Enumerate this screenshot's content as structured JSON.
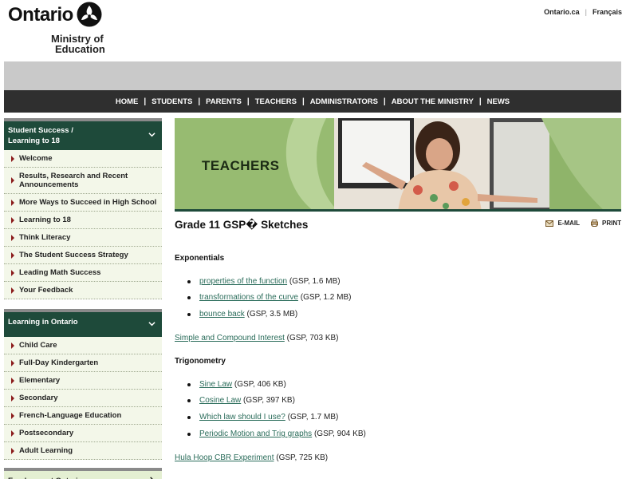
{
  "header": {
    "logo_word": "Ontario",
    "ministry_line1": "Ministry of",
    "ministry_line2": "Education",
    "links": [
      "Ontario.ca",
      "Français"
    ],
    "link_separator": "|"
  },
  "nav": {
    "items": [
      "HOME",
      "STUDENTS",
      "PARENTS",
      "TEACHERS",
      "ADMINISTRATORS",
      "ABOUT THE MINISTRY",
      "NEWS"
    ],
    "separator": "|"
  },
  "sidebar": {
    "section1": {
      "heading_line1": "Student Success /",
      "heading_line2": "Learning to 18",
      "items": [
        "Welcome",
        "Results, Research and Recent Announcements",
        "More Ways to Succeed in High School",
        "Learning to 18",
        "Think Literacy",
        "The Student Success Strategy",
        "Leading Math Success",
        "Your Feedback"
      ]
    },
    "section2": {
      "heading": "Learning in Ontario",
      "items": [
        "Child Care",
        "Full-Day Kindergarten",
        "Elementary",
        "Secondary",
        "French-Language Education",
        "Postsecondary",
        "Adult Learning"
      ]
    },
    "section3": {
      "heading": "Employment Ontario"
    }
  },
  "banner": {
    "title": "TEACHERS"
  },
  "main": {
    "title": "Grade 11 GSP� Sketches",
    "tools": {
      "email": "E-MAIL",
      "print": "PRINT"
    },
    "sections": [
      {
        "heading": "Exponentials",
        "bullets": [
          {
            "link": "properties of the function",
            "meta": "(GSP, 1.6 MB)"
          },
          {
            "link": "transformations of the curve",
            "meta": "(GSP, 1.2 MB)"
          },
          {
            "link": "bounce back",
            "meta": "(GSP, 3.5 MB)"
          }
        ],
        "after": {
          "link": "Simple and Compound Interest",
          "meta": "(GSP, 703 KB)"
        }
      },
      {
        "heading": "Trigonometry",
        "bullets": [
          {
            "link": "Sine Law",
            "meta": "(GSP, 406 KB)"
          },
          {
            "link": "Cosine Law",
            "meta": "(GSP, 397 KB)"
          },
          {
            "link": "Which law should I use?",
            "meta": "(GSP, 1.7 MB)"
          },
          {
            "link": "Periodic Motion and Trig graphs",
            "meta": "(GSP, 904 KB)"
          }
        ],
        "after": {
          "link": "Hula Hoop CBR Experiment",
          "meta": "(GSP, 725 KB)"
        }
      }
    ]
  },
  "colors": {
    "nav_bg": "#2f2f2f",
    "side_head_bg": "#1e4a3a",
    "side_item_bg": "#f3f7e9",
    "link": "#2a6c5a",
    "banner_green": "#8fb46a"
  }
}
